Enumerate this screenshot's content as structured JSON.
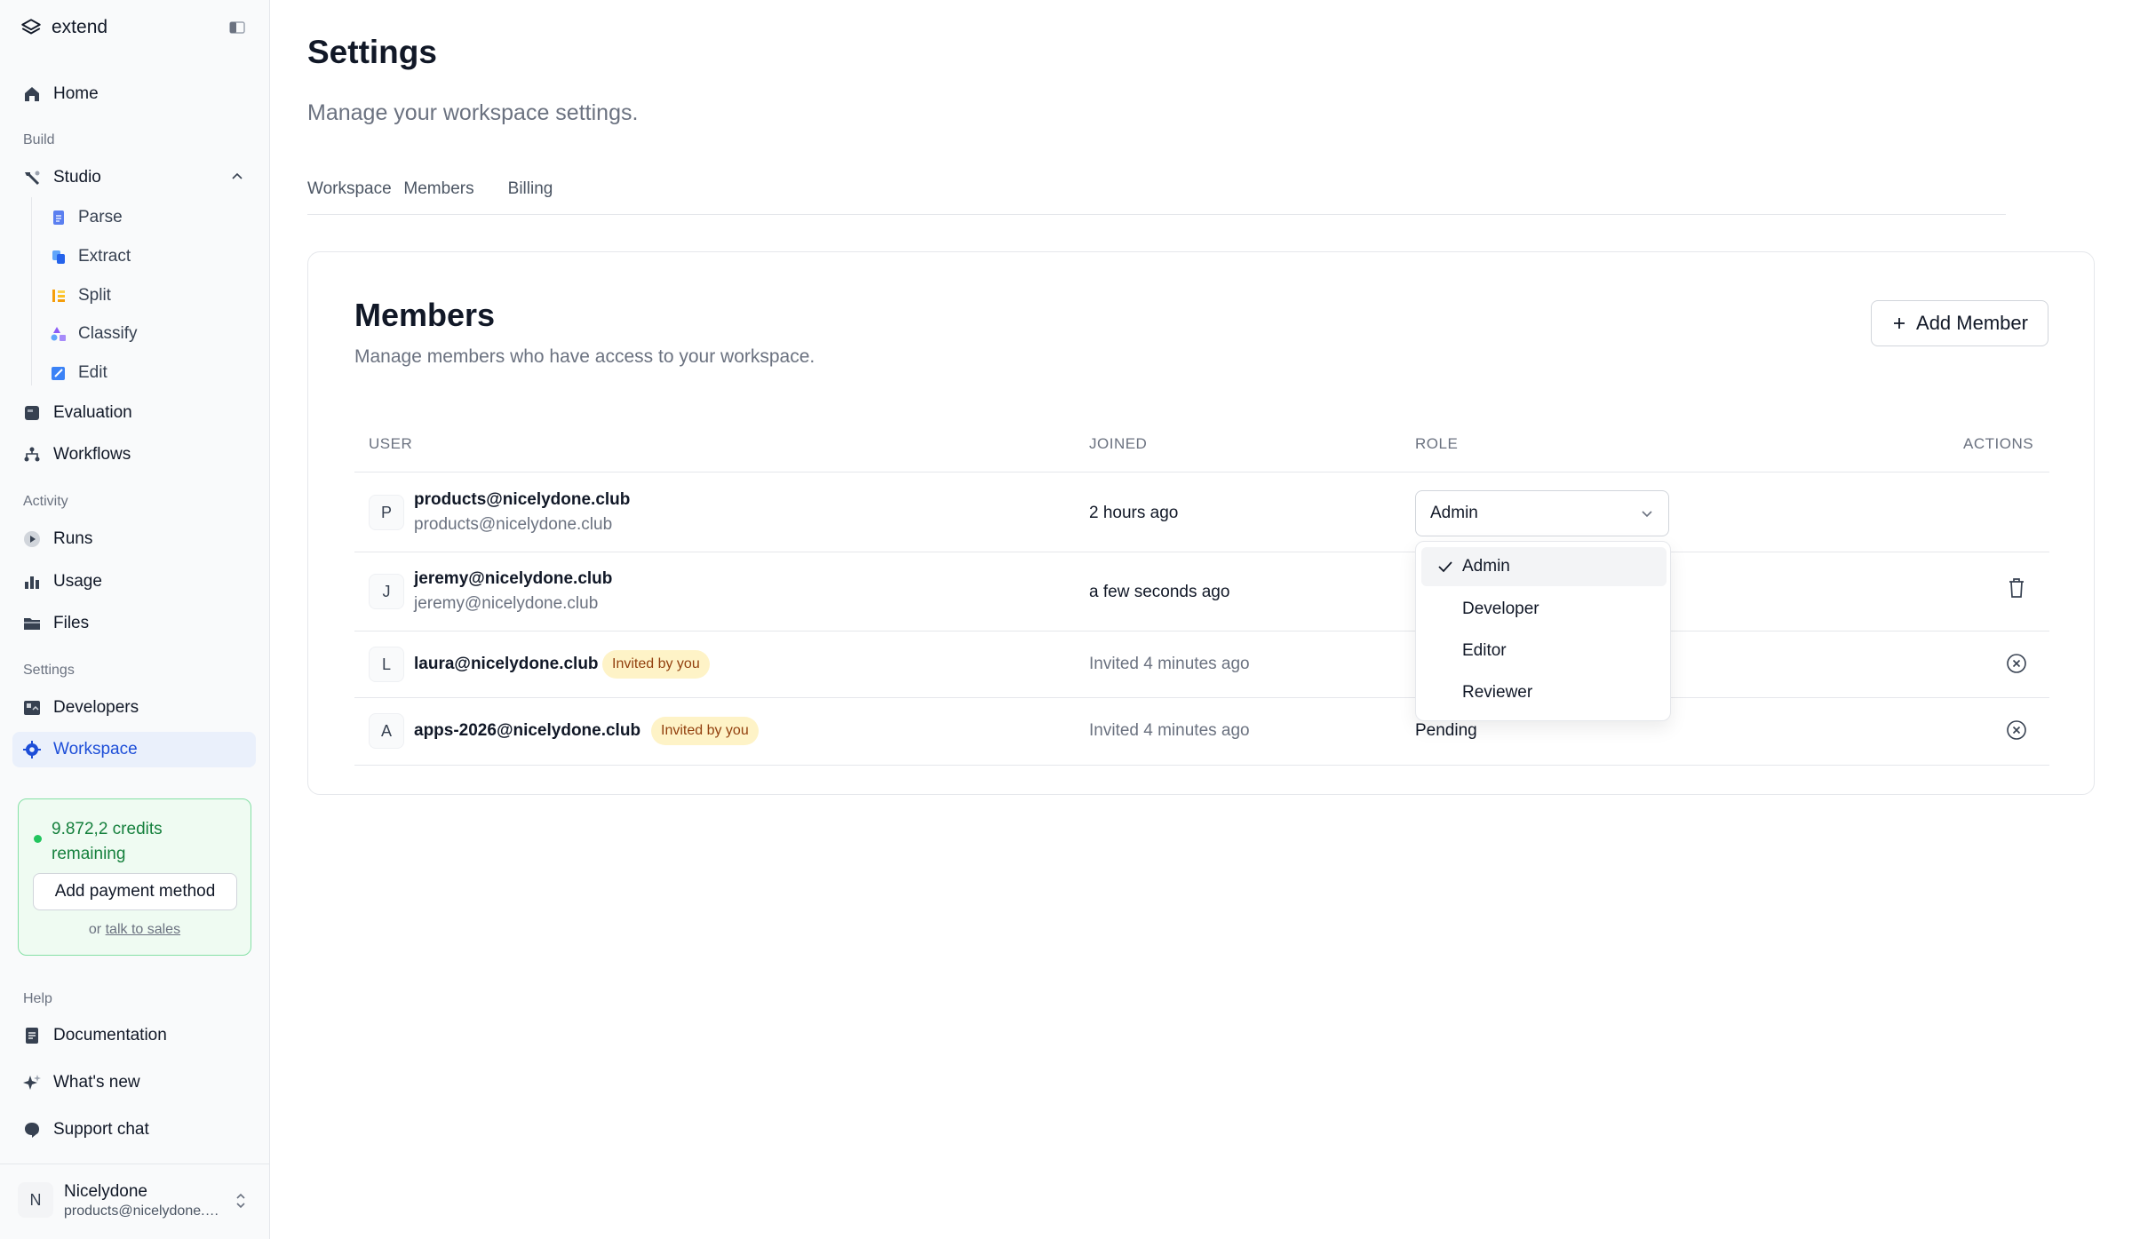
{
  "app": {
    "brand": "extend"
  },
  "sidebar": {
    "home": "Home",
    "sections": {
      "build": "Build",
      "activity": "Activity",
      "settings": "Settings",
      "help": "Help"
    },
    "studio": "Studio",
    "studio_items": [
      "Parse",
      "Extract",
      "Split",
      "Classify",
      "Edit"
    ],
    "evaluation": "Evaluation",
    "workflows": "Workflows",
    "runs": "Runs",
    "usage": "Usage",
    "files": "Files",
    "developers": "Developers",
    "workspace": "Workspace",
    "documentation": "Documentation",
    "whats_new": "What's new",
    "support_chat": "Support chat"
  },
  "credits": {
    "text": "9.872,2 credits remaining",
    "button": "Add payment method",
    "or": "or",
    "talk_link": "talk to sales"
  },
  "user": {
    "initial": "N",
    "name": "Nicelydone",
    "email": "products@nicelydone.club"
  },
  "page": {
    "title": "Settings",
    "subtitle": "Manage your workspace settings.",
    "tabs": [
      "Workspace",
      "Members",
      "Billing"
    ],
    "active_tab": "Members"
  },
  "members": {
    "title": "Members",
    "description": "Manage members who have access to your workspace.",
    "add_button": "Add Member",
    "columns": [
      "USER",
      "JOINED",
      "ROLE",
      "ACTIONS"
    ],
    "rows": [
      {
        "initial": "P",
        "email": "products@nicelydone.club",
        "sub": "products@nicelydone.club",
        "joined": "2 hours ago",
        "role": "Admin"
      },
      {
        "initial": "J",
        "email": "jeremy@nicelydone.club",
        "sub": "jeremy@nicelydone.club",
        "joined": "a few seconds ago",
        "role": ""
      },
      {
        "initial": "L",
        "email": "laura@nicelydone.club",
        "badge": "Invited by you",
        "joined": "Invited 4 minutes ago",
        "role": ""
      },
      {
        "initial": "A",
        "email": "apps-2026@nicelydone.club",
        "badge": "Invited by you",
        "joined": "Invited 4 minutes ago",
        "role": "Pending"
      }
    ]
  },
  "role_dropdown": {
    "options": [
      "Admin",
      "Developer",
      "Editor",
      "Reviewer"
    ],
    "selected": "Admin"
  },
  "colors": {
    "accent": "#1d4ed8",
    "active_nav_bg": "#eaf0fb",
    "credits_green": "#15803d",
    "badge_bg": "#fef3c7"
  }
}
